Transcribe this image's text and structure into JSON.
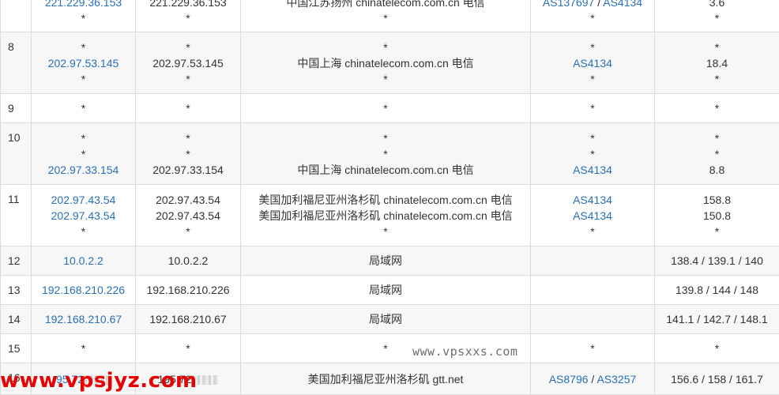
{
  "rows": [
    {
      "hop": "",
      "ips": [
        "221.229.36.153",
        "*"
      ],
      "hosts": [
        "221.229.36.153",
        "*"
      ],
      "locs": [
        "中国江苏扬州 chinatelecom.com.cn 电信",
        "*"
      ],
      "asn": [
        [
          "AS137697",
          "AS4134"
        ],
        [
          "*"
        ]
      ],
      "rtt": [
        "3.6",
        "*"
      ]
    },
    {
      "hop": "8",
      "ips": [
        "*",
        "202.97.53.145",
        "*"
      ],
      "hosts": [
        "*",
        "202.97.53.145",
        "*"
      ],
      "locs": [
        "*",
        "中国上海 chinatelecom.com.cn 电信",
        "*"
      ],
      "asn": [
        [
          "*"
        ],
        [
          "AS4134"
        ],
        [
          "*"
        ]
      ],
      "rtt": [
        "*",
        "18.4",
        "*"
      ]
    },
    {
      "hop": "9",
      "ips": [
        "*"
      ],
      "hosts": [
        "*"
      ],
      "locs": [
        "*"
      ],
      "asn": [
        [
          "*"
        ]
      ],
      "rtt": [
        "*"
      ]
    },
    {
      "hop": "10",
      "ips": [
        "*",
        "*",
        "202.97.33.154"
      ],
      "hosts": [
        "*",
        "*",
        "202.97.33.154"
      ],
      "locs": [
        "*",
        "*",
        "中国上海 chinatelecom.com.cn 电信"
      ],
      "asn": [
        [
          "*"
        ],
        [
          "*"
        ],
        [
          "AS4134"
        ]
      ],
      "rtt": [
        "*",
        "*",
        "8.8"
      ]
    },
    {
      "hop": "11",
      "ips": [
        "202.97.43.54",
        "202.97.43.54",
        "*"
      ],
      "hosts": [
        "202.97.43.54",
        "202.97.43.54",
        "*"
      ],
      "locs": [
        "美国加利福尼亚州洛杉矶 chinatelecom.com.cn 电信",
        "美国加利福尼亚州洛杉矶 chinatelecom.com.cn 电信",
        "*"
      ],
      "asn": [
        [
          "AS4134"
        ],
        [
          "AS4134"
        ],
        [
          "*"
        ]
      ],
      "rtt": [
        "158.8",
        "150.8",
        "*"
      ]
    },
    {
      "hop": "12",
      "ips": [
        "10.0.2.2"
      ],
      "hosts": [
        "10.0.2.2"
      ],
      "locs": [
        "局域网"
      ],
      "asn": [
        []
      ],
      "rtt": [
        "138.4 / 139.1 / 140"
      ]
    },
    {
      "hop": "13",
      "ips": [
        "192.168.210.226"
      ],
      "hosts": [
        "192.168.210.226"
      ],
      "locs": [
        "局域网"
      ],
      "asn": [
        []
      ],
      "rtt": [
        "139.8 / 144 / 148"
      ]
    },
    {
      "hop": "14",
      "ips": [
        "192.168.210.67"
      ],
      "hosts": [
        "192.168.210.67"
      ],
      "locs": [
        "局域网"
      ],
      "asn": [
        []
      ],
      "rtt": [
        "141.1 / 142.7 / 148.1"
      ]
    },
    {
      "hop": "15",
      "ips": [
        "*"
      ],
      "hosts": [
        "*"
      ],
      "locs": [
        "*"
      ],
      "asn": [
        [
          "*"
        ]
      ],
      "rtt": [
        "*"
      ]
    },
    {
      "hop": "16",
      "ips": [
        "95.72"
      ],
      "hosts": [
        "195.72"
      ],
      "locs": [
        "美国加利福尼亚州洛杉矶 gtt.net"
      ],
      "asn": [
        [
          "AS8796",
          "AS3257"
        ]
      ],
      "rtt": [
        "156.6 / 158 / 161.7"
      ]
    }
  ],
  "watermark": "www.vpsxxs.com",
  "site_mark": "www.vpsjyz.com"
}
